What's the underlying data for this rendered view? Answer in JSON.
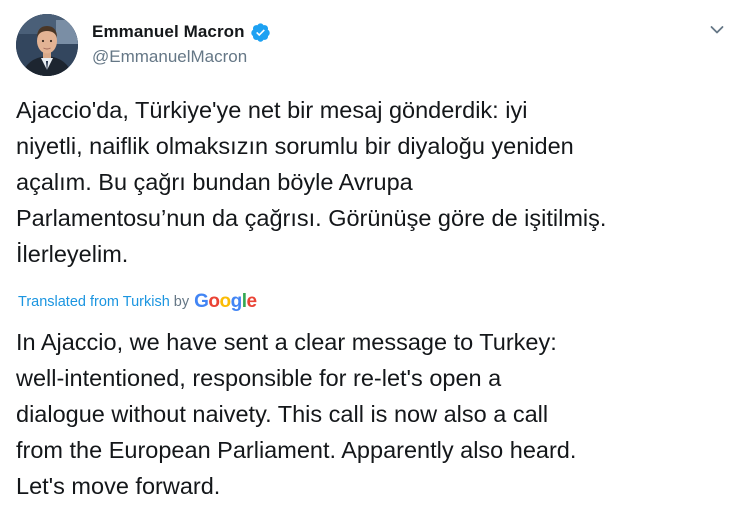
{
  "author": {
    "display_name": "Emmanuel Macron",
    "handle": "@EmmanuelMacron",
    "verified": true,
    "verified_icon": "verified-badge-icon",
    "avatar": "avatar-photo"
  },
  "menu": {
    "icon": "chevron-down-icon"
  },
  "tweet": {
    "original_text": "Ajaccio'da, Türkiye'ye net bir mesaj gönderdik: iyi niyetli, naiflik olmaksızın sorumlu bir diyaloğu yeniden açalım. Bu çağrı bundan böyle Avrupa Parlamentosu’nun da çağrısı. Görünüşe göre de işitilmiş. İlerleyelim.",
    "original_lines": [
      "Ajaccio'da, Türkiye'ye net bir mesaj gönderdik: iyi",
      "niyetli, naiflik olmaksızın sorumlu bir diyaloğu yeniden",
      "açalım. Bu çağrı bundan böyle Avrupa",
      "Parlamentosu’nun da çağrısı. Görünüşe göre de işitilmiş.",
      "İlerleyelim."
    ],
    "translated_from_label": "Translated from Turkish",
    "by_label": "by",
    "translator_brand": "Google",
    "translation_lines": [
      "In Ajaccio, we have sent a clear message to Turkey:",
      "well-intentioned, responsible for re-let's open a",
      "dialogue without naivety. This call is now also a call",
      "from the European Parliament. Apparently also heard.",
      "Let's move forward."
    ]
  },
  "colors": {
    "text": "#14171a",
    "secondary": "#657786",
    "link": "#1b95e0",
    "verified": "#1da1f2",
    "google_blue": "#4285f4",
    "google_red": "#ea4335",
    "google_yellow": "#fbbc05",
    "google_green": "#34a853"
  }
}
